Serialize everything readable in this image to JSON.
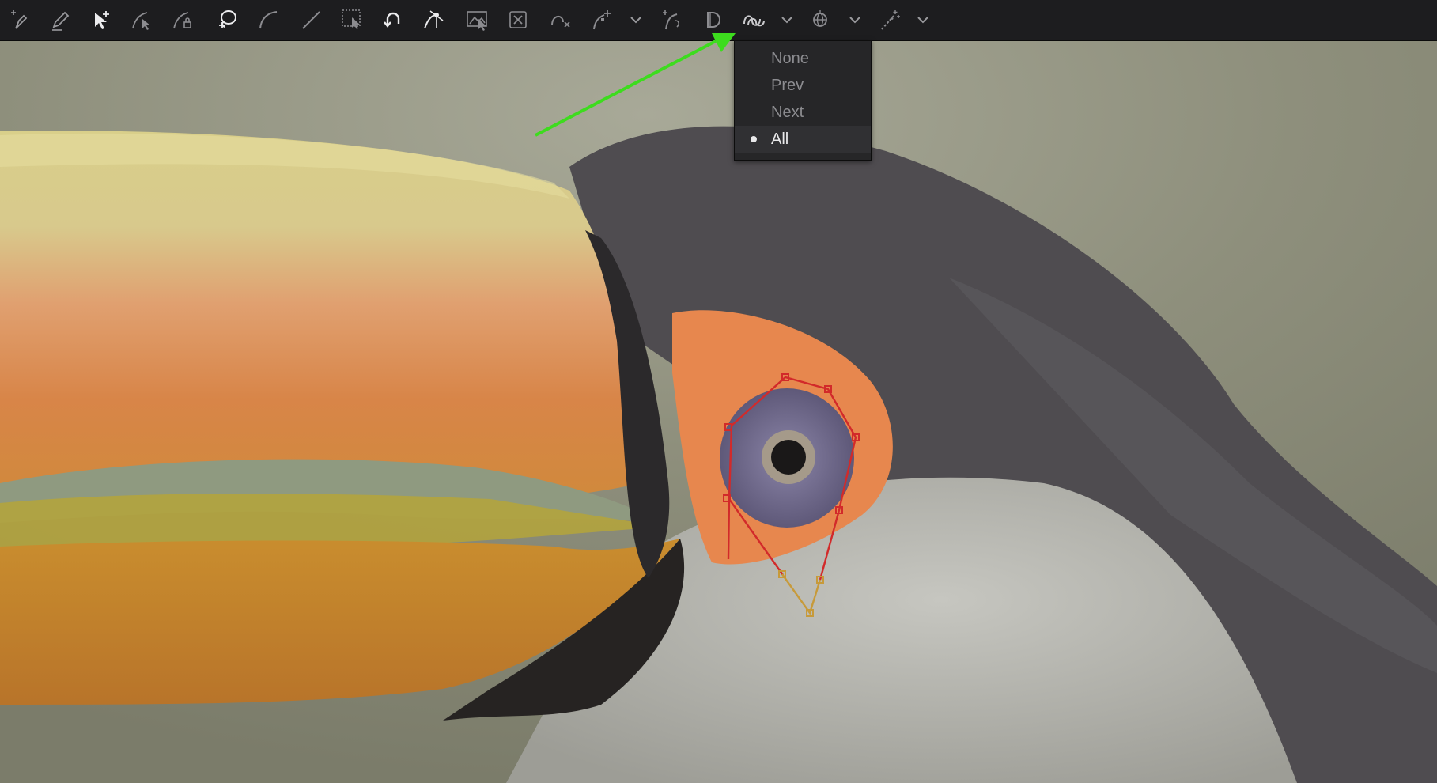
{
  "toolbar": {
    "icons": [
      "add-point-pen-icon",
      "pencil-icon",
      "select-add-icon",
      "bezier-select-icon",
      "polyline-lock-icon",
      "lasso-add-icon",
      "curve-icon",
      "line-icon",
      "marquee-select-icon",
      "undo-curve-icon",
      "node-edit-icon",
      "transform-box-icon",
      "delete-x-icon",
      "smooth-x-icon",
      "add-handle-icon",
      "chevron-down-icon",
      "reshape-icon",
      "d-shape-icon",
      "onion-skin-icon",
      "chevron-down-icon",
      "mesh-icon",
      "chevron-down-icon",
      "magic-wand-icon",
      "chevron-down-icon"
    ]
  },
  "onion_menu": {
    "options": [
      {
        "label": "None",
        "selected": false
      },
      {
        "label": "Prev",
        "selected": false
      },
      {
        "label": "Next",
        "selected": false
      },
      {
        "label": "All",
        "selected": true
      }
    ]
  },
  "colors": {
    "toolbar_bg": "#1d1d1f",
    "menu_bg": "#262628",
    "arrow": "#3ddc1e",
    "spline_red": "#d22a2a",
    "spline_gold": "#c79a3a"
  }
}
